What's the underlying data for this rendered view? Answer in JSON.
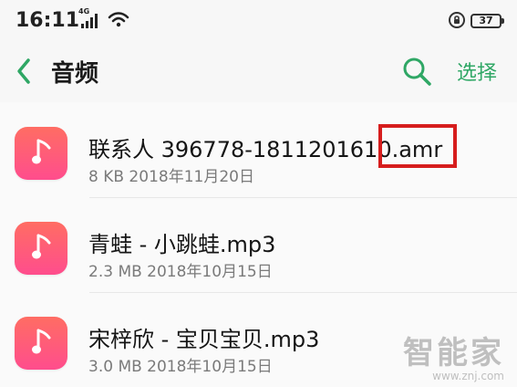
{
  "status": {
    "time": "16:11",
    "network": "4G",
    "battery": "37"
  },
  "header": {
    "title": "音频",
    "select_label": "选择"
  },
  "icons": {
    "back": "chevron-left-icon",
    "search": "search-icon",
    "file": "music-note-icon",
    "lock": "lock-icon",
    "wifi": "wifi-icon"
  },
  "colors": {
    "accent": "#2fa765",
    "file_icon_gradient_top": "#ff6d63",
    "file_icon_gradient_bottom": "#ff4d8d",
    "highlight": "#d61d1d"
  },
  "files": [
    {
      "name": "联系人 396778-1811201610.amr",
      "meta": "8 KB  2018年11月20日"
    },
    {
      "name": "青蛙 - 小跳蛙.mp3",
      "meta": "2.3 MB  2018年10月15日"
    },
    {
      "name": "宋梓欣 - 宝贝宝贝.mp3",
      "meta": "3.0 MB  2018年10月15日"
    }
  ],
  "watermark": {
    "main": "智能家",
    "url": "www.znj.com"
  }
}
